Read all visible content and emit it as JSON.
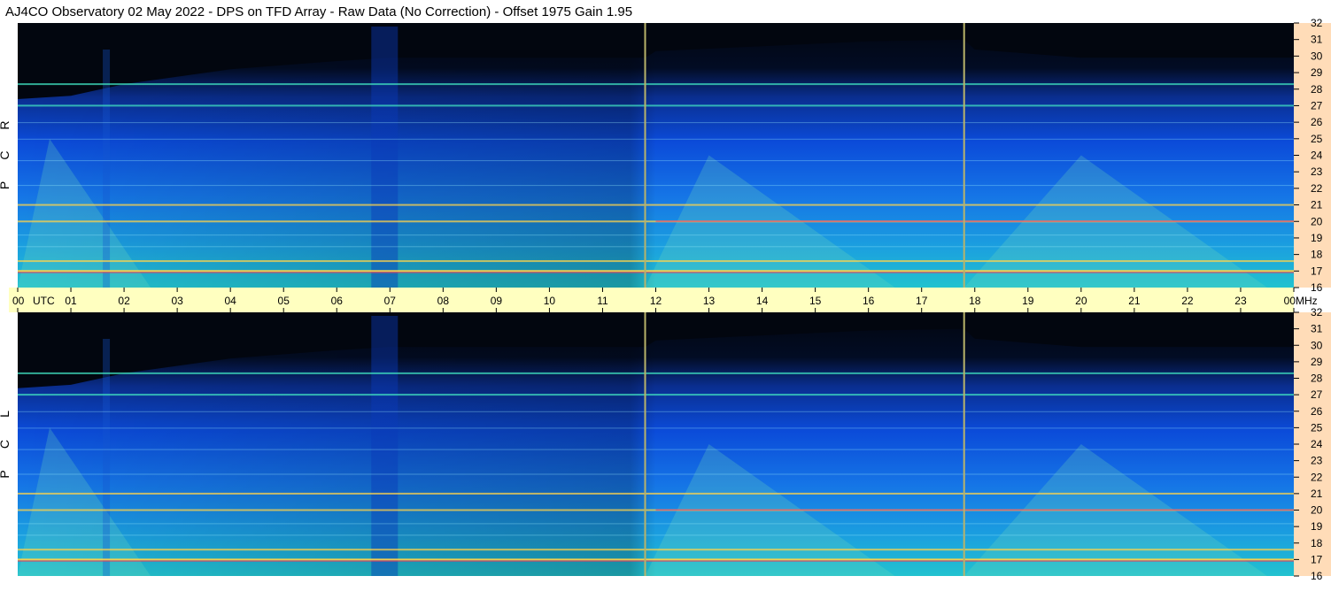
{
  "chart_data": {
    "type": "heatmap",
    "title": "AJ4CO Observatory  02 May 2022  -  DPS on TFD Array  -  Raw Data (No Correction)  -  Offset 1975  Gain 1.95",
    "x_unit": "UTC",
    "y_unit": "MHz",
    "x_ticks": [
      "00",
      "01",
      "02",
      "03",
      "04",
      "05",
      "06",
      "07",
      "08",
      "09",
      "10",
      "11",
      "12",
      "13",
      "14",
      "15",
      "16",
      "17",
      "18",
      "19",
      "20",
      "21",
      "22",
      "23",
      "00"
    ],
    "y_ticks": [
      32,
      31,
      30,
      29,
      28,
      27,
      26,
      25,
      24,
      23,
      22,
      21,
      20,
      19,
      18,
      17,
      16
    ],
    "xlim": [
      0,
      24
    ],
    "ylim": [
      16,
      32
    ],
    "panels": [
      {
        "label": [
          "R",
          "C",
          "P"
        ]
      },
      {
        "label": [
          "L",
          "C",
          "P"
        ]
      }
    ],
    "markers_utc": [
      11.8,
      17.8
    ],
    "strong_bands_mhz": [
      17.0,
      17.6,
      20.0,
      21.0,
      27.0,
      28.3
    ],
    "colors": {
      "background_top": "#030914",
      "mid": "#0b49d8",
      "low": "#17a9e0",
      "bright": "#6fdcb9",
      "band": "#ffd34a",
      "marker": "#b8b36a",
      "axis_band": "#ffffc0",
      "right_axis_bg": "#ffdcb8"
    }
  }
}
